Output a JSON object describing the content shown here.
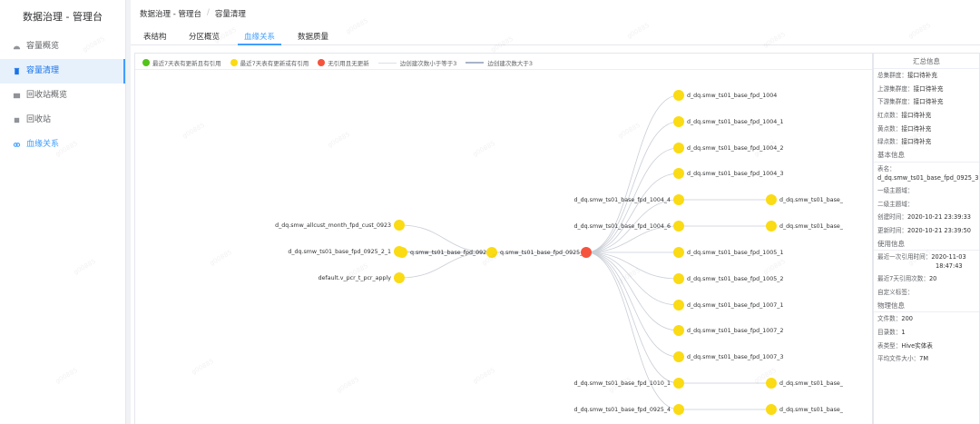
{
  "sidebar": {
    "title": "数据治理 - 管理台",
    "items": [
      {
        "label": "容量概览",
        "icon": "dashboard-icon"
      },
      {
        "label": "容量清理",
        "icon": "trash-icon"
      },
      {
        "label": "回收站概览",
        "icon": "folder-icon"
      },
      {
        "label": "回收站",
        "icon": "box-icon"
      },
      {
        "label": "血缘关系",
        "icon": "link-icon"
      }
    ],
    "active_index": 1
  },
  "breadcrumb": [
    "数据治理 - 管理台",
    "容量清理"
  ],
  "tabs": [
    "表结构",
    "分区概览",
    "血缘关系",
    "数据质量"
  ],
  "active_tab": 2,
  "legend": {
    "items": [
      {
        "label": "最近7天表有更新且有引用",
        "color": "#52c41a"
      },
      {
        "label": "最近7天表有更新或有引用",
        "color": "#fadb14"
      },
      {
        "label": "无引用且无更新",
        "color": "#f5533d"
      }
    ],
    "lines": [
      {
        "label": "边创建次数小于等于3",
        "color": "#dcdfe6"
      },
      {
        "label": "边创建次数大于3",
        "color": "#a9b4c8"
      }
    ]
  },
  "colors": {
    "node_yellow": "#fadb14",
    "node_red": "#f5533d",
    "edge": "#c9ced6",
    "accent": "#409eff"
  },
  "graph": {
    "upstream": [
      "d_dq.smw_allcust_month_fpd_cust_0923",
      "d_dq.smw_ts01_base_fpd_0925_2_1",
      "default.v_pcr_t_pcr_apply"
    ],
    "middle1": "q.smw_ts01_base_fpd_0925_2",
    "middle2": "q.smw_ts01_base_fpd_0925_3",
    "downstream": [
      {
        "label": "d_dq.smw_ts01_base_fpd_1004",
        "child": null
      },
      {
        "label": "d_dq.smw_ts01_base_fpd_1004_1",
        "child": null
      },
      {
        "label": "d_dq.smw_ts01_base_fpd_1004_2",
        "child": null
      },
      {
        "label": "d_dq.smw_ts01_base_fpd_1004_3",
        "child": null
      },
      {
        "label": "d_dq.smw_ts01_base_fpd_1004_4",
        "child": "d_dq.smw_ts01_base_"
      },
      {
        "label": "d_dq.smw_ts01_base_fpd_1004_6",
        "child": "d_dq.smw_ts01_base_"
      },
      {
        "label": "d_dq.smw_ts01_base_fpd_1005_1",
        "child": null
      },
      {
        "label": "d_dq.smw_ts01_base_fpd_1005_2",
        "child": null
      },
      {
        "label": "d_dq.smw_ts01_base_fpd_1007_1",
        "child": null
      },
      {
        "label": "d_dq.smw_ts01_base_fpd_1007_2",
        "child": null
      },
      {
        "label": "d_dq.smw_ts01_base_fpd_1007_3",
        "child": null
      },
      {
        "label": "d_dq.smw_ts01_base_fpd_1010_1",
        "child": "d_dq.smw_ts01_base_"
      },
      {
        "label": "d_dq.smw_ts01_base_fpd_0925_4",
        "child": "d_dq.smw_ts01_base_"
      }
    ]
  },
  "info": {
    "header": "汇总信息",
    "summary": [
      {
        "k": "总集群度：",
        "v": "接口待补充"
      },
      {
        "k": "上游集群度：",
        "v": "接口待补充"
      },
      {
        "k": "下游集群度：",
        "v": "接口待补充"
      },
      {
        "k": "红点数：",
        "v": "接口待补充"
      },
      {
        "k": "黄点数：",
        "v": "接口待补充"
      },
      {
        "k": "绿点数：",
        "v": "接口待补充"
      }
    ],
    "basic_title": "基本信息",
    "table_name_key": "表名：",
    "table_name": "d_dq.smw_ts01_base_fpd_0925_3",
    "basic": [
      {
        "k": "一级主题域：",
        "v": ""
      },
      {
        "k": "二级主题域：",
        "v": ""
      },
      {
        "k": "创建时间：",
        "v": "2020-10-21 23:39:33"
      },
      {
        "k": "更新时间：",
        "v": "2020-10-21 23:39:50"
      }
    ],
    "usage_title": "使用信息",
    "last_ref_key": "最近一次引用时间：",
    "last_ref_date": "2020-11-03",
    "last_ref_time": "18:47:43",
    "usage": [
      {
        "k": "最近7天引用次数：",
        "v": "20"
      },
      {
        "k": "自定义标签：",
        "v": ""
      }
    ],
    "physical_title": "物理信息",
    "physical": [
      {
        "k": "文件数：",
        "v": "200"
      },
      {
        "k": "目录数：",
        "v": "1"
      },
      {
        "k": "表类型：",
        "v": "Hive实体表"
      },
      {
        "k": "平均文件大小：",
        "v": "7M"
      }
    ]
  },
  "watermark_text": "g00885"
}
